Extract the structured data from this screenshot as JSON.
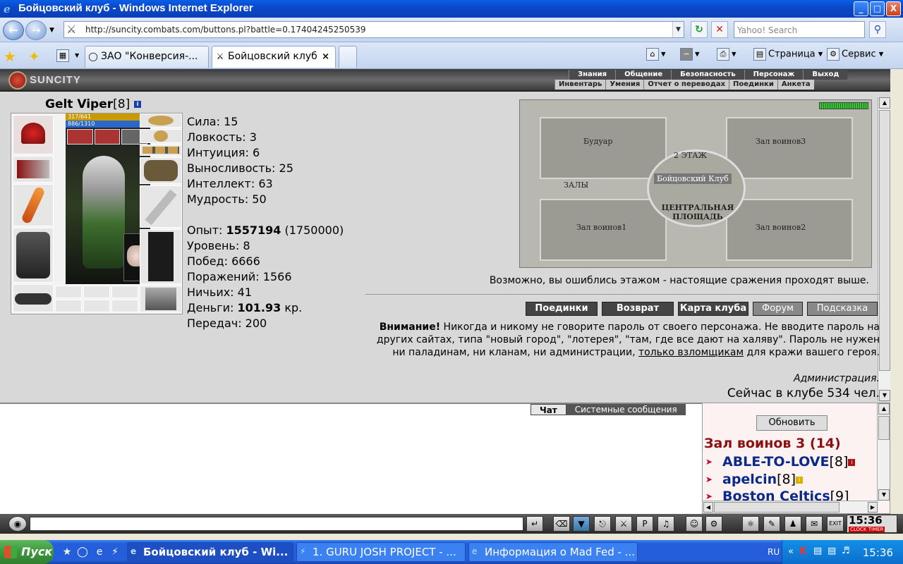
{
  "window": {
    "title": "Бойцовский клуб - Windows Internet Explorer",
    "minimize": "_",
    "maximize": "□",
    "close": "X"
  },
  "addressbar": {
    "url": "http://suncity.combats.com/buttons.pl?battle=0.17404245250539",
    "search_placeholder": "Yahoo! Search"
  },
  "tabs": [
    {
      "label": "ЗАО \"Конверсия-...",
      "active": false
    },
    {
      "label": "Бойцовский клуб",
      "active": true
    }
  ],
  "toolbar": {
    "page_label": "Страница",
    "service_label": "Сервис"
  },
  "game": {
    "logo": "SUNCITY",
    "top_menu": [
      "Знания",
      "Общение",
      "Безопасность",
      "Персонаж",
      "Выход"
    ],
    "sub_menu": [
      "Инвентарь",
      "Умения",
      "Отчет о переводах",
      "Поединки",
      "Анкета"
    ],
    "character": {
      "name": "Gelt Viper",
      "level_tag": "[8]",
      "hp": "317/641",
      "mana": "886/1310"
    },
    "stats": {
      "strength": "Сила: 15",
      "agility": "Ловкость: 3",
      "intuition": "Интуиция: 6",
      "endurance": "Выносливость: 25",
      "intellect": "Интеллект: 63",
      "wisdom": "Мудрость: 50",
      "exp_label": "Опыт: ",
      "exp_value": "1557194",
      "exp_next": " (1750000)",
      "level": "Уровень: 8",
      "wins": "Побед: 6666",
      "losses": "Поражений: 1566",
      "draws": "Ничьих: 41",
      "money_label": "Деньги: ",
      "money_value": "101.93",
      "money_unit": " кр.",
      "transfers": "Передач: 200"
    },
    "map": {
      "floor": "2 ЭТАЖ",
      "club": "Бойцовский Клуб",
      "boudoir": "Будуар",
      "hall3": "Зал воинов3",
      "halls": "ЗАЛЫ",
      "central": "ЦЕНТРАЛЬНАЯ ПЛОЩАДЬ",
      "hall1": "Зал воинов1",
      "hall2": "Зал воинов2"
    },
    "floor_message": "Возможно, вы ошиблись этажом - настоящие сражения проходят выше.",
    "buttons": [
      "Поединки",
      "Возврат",
      "Карта клуба",
      "Форум",
      "Подсказка"
    ],
    "warning": {
      "bold": "Внимание!",
      "text": " Никогда и никому не говорите пароль от своего персонажа. Не вводите пароль на других сайтах, типа \"новый город\", \"лотерея\", \"там, где все дают на халяву\". Пароль не нужен ни паладинам, ни кланам, ни администрации, ",
      "link": "только взломщикам",
      "tail": " для кражи вашего героя."
    },
    "admin": "Администрация.",
    "online": "Сейчас в клубе 534 чел."
  },
  "chat": {
    "tab_chat": "Чат",
    "tab_system": "Системные сообщения"
  },
  "sidebar": {
    "refresh": "Обновить",
    "room": "Зал воинов 3 (14)",
    "players": [
      {
        "name": "ABLE-TO-LOVE",
        "level": "[8]"
      },
      {
        "name": "apelcin",
        "level": "[8]"
      },
      {
        "name": "Boston Celtics",
        "level": "[9]"
      }
    ]
  },
  "bottombar": {
    "clock": "15:36",
    "clock_label": "CLOCK TIMER"
  },
  "taskbar": {
    "start": "Пуск",
    "tasks": [
      {
        "label": "Бойцовский клуб - Wi...",
        "active": true
      },
      {
        "label": "1. GURU JOSH PROJECT - ...",
        "active": false
      },
      {
        "label": "Информация о Mad Fed - ...",
        "active": false
      }
    ],
    "lang": "RU",
    "time": "15:36"
  }
}
